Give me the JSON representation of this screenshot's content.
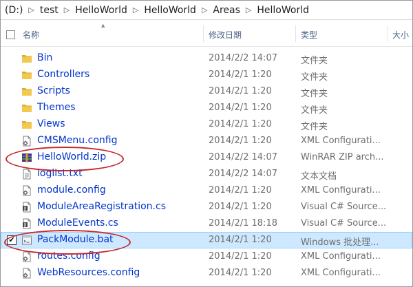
{
  "breadcrumb": {
    "segments": [
      "(D:)",
      "test",
      "HelloWorld",
      "HelloWorld",
      "Areas",
      "HelloWorld"
    ]
  },
  "columns": {
    "name": "名称",
    "date": "修改日期",
    "type": "类型",
    "size": "大小"
  },
  "files": [
    {
      "name": "Bin",
      "date": "2014/2/2 14:07",
      "type": "文件夹",
      "icon": "folder-icon"
    },
    {
      "name": "Controllers",
      "date": "2014/2/1 1:20",
      "type": "文件夹",
      "icon": "folder-icon"
    },
    {
      "name": "Scripts",
      "date": "2014/2/1 1:20",
      "type": "文件夹",
      "icon": "folder-icon"
    },
    {
      "name": "Themes",
      "date": "2014/2/1 1:20",
      "type": "文件夹",
      "icon": "folder-icon"
    },
    {
      "name": "Views",
      "date": "2014/2/1 1:20",
      "type": "文件夹",
      "icon": "folder-icon"
    },
    {
      "name": "CMSMenu.config",
      "date": "2014/2/1 1:20",
      "type": "XML Configurati...",
      "icon": "config-file-icon"
    },
    {
      "name": "HelloWorld.zip",
      "date": "2014/2/2 14:07",
      "type": "WinRAR ZIP arch...",
      "icon": "winrar-archive-icon"
    },
    {
      "name": "loglist.txt",
      "date": "2014/2/2 14:07",
      "type": "文本文档",
      "icon": "text-file-icon"
    },
    {
      "name": "module.config",
      "date": "2014/2/1 1:20",
      "type": "XML Configurati...",
      "icon": "config-file-icon"
    },
    {
      "name": "ModuleAreaRegistration.cs",
      "date": "2014/2/1 1:20",
      "type": "Visual C# Source...",
      "icon": "csharp-file-icon"
    },
    {
      "name": "ModuleEvents.cs",
      "date": "2014/2/1 18:18",
      "type": "Visual C# Source...",
      "icon": "csharp-file-icon"
    },
    {
      "name": "PackModule.bat",
      "date": "2014/2/1 1:20",
      "type": "Windows 批处理...",
      "icon": "batch-file-icon",
      "selected": true
    },
    {
      "name": "routes.config",
      "date": "2014/2/1 1:20",
      "type": "XML Configurati...",
      "icon": "config-file-icon"
    },
    {
      "name": "WebResources.config",
      "date": "2014/2/1 1:20",
      "type": "XML Configurati...",
      "icon": "config-file-icon"
    }
  ],
  "colors": {
    "link": "#0033cc",
    "selection": "#cde8ff",
    "annotation": "#c6282b",
    "folder": "#e8b84a"
  }
}
